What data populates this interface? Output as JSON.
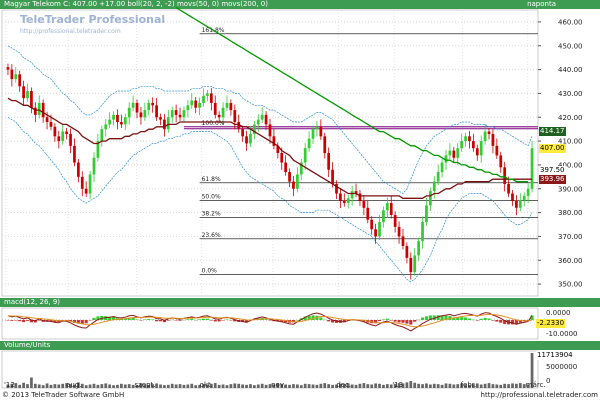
{
  "price_panel": {
    "header": "Magyar Telekom  C: 407.00  +17.00  boll(20, 2, -2)  movs(50, 0)  movs(200, 0)",
    "period": "naponta",
    "watermark_title": "TeleTrader Professional",
    "watermark_url": "http://professional.teletrader.com",
    "badges": [
      {
        "text": "414.17",
        "bg": "#1f5f1f",
        "fg": "#ffffff"
      },
      {
        "text": "407.00",
        "bg": "#ffeb3b",
        "fg": "#000000"
      },
      {
        "text": "397.50",
        "bg": "#ffffff",
        "fg": "#000000"
      },
      {
        "text": "393.96",
        "bg": "#8b1a1a",
        "fg": "#ffffff"
      }
    ]
  },
  "macd_panel": {
    "header": "macd(12, 26, 9)",
    "badges": [
      {
        "text": "-2.2330",
        "bg": "#ffeb3b",
        "fg": "#000000"
      }
    ],
    "tick_labels": [
      "0.0000",
      "-10.0000"
    ]
  },
  "volume_panel": {
    "header": "Volume/Units",
    "badges": [
      {
        "text": "11713904",
        "bg": "#ffffff",
        "fg": "#000000"
      }
    ],
    "tick_labels": [
      "5000000",
      "0"
    ]
  },
  "footer": {
    "copyright": "© 2013 TeleTrader Software GmbH",
    "url": "http://professional.teletrader.com"
  },
  "colors": {
    "header_bg": "#3e9b52",
    "up_candle": "#33cc33",
    "down_candle": "#cc0000",
    "sma50": "#7a1010",
    "sma200": "#009900",
    "bollinger": "#2b8fd6",
    "fib": "#000000",
    "resistance": "#800080",
    "macd_line": "#8b1a1a",
    "signal_line": "#e09020"
  },
  "chart_data": [
    {
      "type": "candlestick",
      "y_ticks": [
        350,
        360,
        370,
        380,
        390,
        400,
        410,
        420,
        430,
        440,
        450,
        460
      ],
      "ylim": [
        345,
        465
      ],
      "x_tick_labels": [
        "'12",
        "aug.",
        "szept.",
        "okt.",
        "nov.",
        "dec.",
        "'13",
        "febr.",
        "márc."
      ],
      "fibonacci": [
        {
          "label": "161.8%",
          "value": 455.0
        },
        {
          "label": "100.0%",
          "value": 416.0
        },
        {
          "label": "61.8%",
          "value": 392.5
        },
        {
          "label": "50.0%",
          "value": 385.0
        },
        {
          "label": "38.2%",
          "value": 378.0
        },
        {
          "label": "23.6%",
          "value": 369.0
        },
        {
          "label": "0.0%",
          "value": 354.0
        }
      ],
      "resistance_level": 416.0,
      "series_close": [
        440,
        436,
        438,
        433,
        428,
        431,
        424,
        421,
        426,
        420,
        418,
        416,
        412,
        410,
        414,
        413,
        408,
        401,
        395,
        390,
        388,
        396,
        403,
        410,
        415,
        417,
        419,
        421,
        418,
        417,
        420,
        424,
        426,
        422,
        420,
        423,
        426,
        425,
        420,
        419,
        415,
        420,
        423,
        421,
        420,
        423,
        425,
        427,
        424,
        426,
        429,
        430,
        426,
        421,
        420,
        424,
        426,
        423,
        418,
        415,
        412,
        409,
        413,
        417,
        419,
        421,
        417,
        412,
        408,
        405,
        401,
        397,
        393,
        390,
        396,
        401,
        407,
        411,
        415,
        416,
        412,
        405,
        398,
        392,
        388,
        385,
        384,
        386,
        389,
        388,
        385,
        382,
        377,
        373,
        370,
        376,
        381,
        384,
        379,
        374,
        370,
        366,
        361,
        355,
        362,
        368,
        376,
        383,
        389,
        393,
        397,
        401,
        404,
        406,
        403,
        407,
        410,
        412,
        410,
        407,
        404,
        410,
        414,
        413,
        408,
        404,
        399,
        392,
        388,
        385,
        382,
        385,
        387,
        390,
        407
      ],
      "series_sma50": [
        428,
        427,
        427,
        426,
        425,
        425,
        424,
        423,
        423,
        422,
        421,
        420,
        419,
        418,
        417,
        417,
        416,
        415,
        414,
        412,
        411,
        410,
        409,
        409,
        410,
        410,
        411,
        411,
        411,
        411,
        412,
        412,
        413,
        413,
        414,
        414,
        415,
        415,
        416,
        416,
        416,
        417,
        417,
        417,
        418,
        418,
        418,
        418,
        418,
        418,
        418,
        418,
        418,
        418,
        418,
        418,
        418,
        418,
        417,
        417,
        416,
        416,
        415,
        414,
        413,
        412,
        411,
        410,
        409,
        408,
        406,
        405,
        404,
        402,
        401,
        400,
        399,
        398,
        397,
        396,
        395,
        394,
        393,
        392,
        391,
        390,
        389,
        388,
        388,
        388,
        387,
        387,
        387,
        387,
        387,
        387,
        387,
        387,
        387,
        387,
        387,
        386,
        386,
        386,
        386,
        386,
        386,
        387,
        387,
        388,
        388,
        389,
        390,
        390,
        391,
        392,
        392,
        393,
        393,
        393,
        393,
        393,
        393,
        393,
        394,
        394,
        394,
        394,
        394,
        394,
        394,
        394,
        394,
        394,
        394
      ],
      "series_sma200_start_index": 43,
      "series_sma200": [
        466,
        465,
        464,
        463,
        462,
        461,
        460,
        459,
        458,
        457,
        456,
        455,
        454,
        453,
        452,
        451,
        450,
        449,
        448,
        447,
        446,
        445,
        444,
        443,
        442,
        441,
        440,
        439,
        438,
        437,
        436,
        435,
        434,
        433,
        432,
        431,
        430,
        429,
        428,
        427,
        426,
        425,
        424,
        423,
        422,
        421,
        420,
        419,
        418,
        417,
        416,
        415,
        414,
        414,
        413,
        412,
        411,
        411,
        410,
        409,
        408,
        408,
        407,
        406,
        406,
        405,
        404,
        404,
        403,
        402,
        402,
        401,
        401,
        400,
        400,
        399,
        399,
        398,
        398,
        397,
        397,
        396,
        396,
        395,
        395,
        394,
        394,
        393,
        393,
        393,
        393
      ],
      "series_bb_upper": [
        450,
        449,
        448,
        447,
        445,
        444,
        443,
        441,
        440,
        438,
        437,
        436,
        434,
        432,
        430,
        429,
        427,
        426,
        424,
        422,
        421,
        421,
        422,
        423,
        425,
        427,
        429,
        430,
        431,
        431,
        431,
        431,
        432,
        432,
        433,
        433,
        433,
        433,
        432,
        432,
        431,
        431,
        431,
        431,
        431,
        431,
        431,
        432,
        432,
        432,
        433,
        433,
        433,
        432,
        432,
        432,
        431,
        431,
        430,
        430,
        428,
        427,
        426,
        425,
        425,
        425,
        424,
        423,
        423,
        422,
        421,
        420,
        419,
        418,
        418,
        418,
        419,
        420,
        421,
        422,
        422,
        421,
        420,
        419,
        417,
        415,
        413,
        411,
        409,
        407,
        405,
        403,
        401,
        399,
        397,
        395,
        393,
        392,
        391,
        390,
        389,
        388,
        390,
        394,
        398,
        402,
        405,
        408,
        410,
        412,
        413,
        414,
        415,
        416,
        417,
        417,
        418,
        418,
        418,
        417,
        417,
        417,
        417,
        416,
        416,
        415,
        415,
        414,
        413,
        412,
        411,
        410,
        409,
        408,
        412
      ],
      "series_bb_lower": [
        420,
        419,
        418,
        416,
        414,
        413,
        411,
        409,
        408,
        406,
        404,
        402,
        400,
        398,
        395,
        393,
        390,
        388,
        386,
        385,
        384,
        385,
        386,
        387,
        389,
        391,
        393,
        395,
        397,
        398,
        400,
        402,
        404,
        405,
        406,
        407,
        408,
        409,
        409,
        410,
        410,
        411,
        411,
        412,
        412,
        413,
        413,
        414,
        414,
        414,
        414,
        414,
        414,
        413,
        412,
        411,
        410,
        408,
        405,
        402,
        399,
        397,
        395,
        394,
        393,
        392,
        391,
        390,
        389,
        387,
        386,
        385,
        383,
        382,
        381,
        380,
        380,
        380,
        380,
        381,
        381,
        381,
        381,
        380,
        379,
        378,
        377,
        376,
        375,
        374,
        373,
        372,
        371,
        370,
        368,
        366,
        364,
        362,
        360,
        358,
        356,
        354,
        352,
        351,
        352,
        354,
        356,
        359,
        362,
        366,
        370,
        373,
        377,
        380,
        382,
        384,
        386,
        387,
        388,
        388,
        388,
        388,
        387,
        386,
        385,
        383,
        381,
        379,
        377,
        376,
        375,
        375,
        376,
        377,
        380
      ],
      "series_volume_relative": [
        0.1,
        0.12,
        0.14,
        0.09,
        0.15,
        0.11,
        0.3,
        0.12,
        0.1,
        0.08,
        0.13,
        0.09,
        0.11,
        0.1,
        0.12,
        0.14,
        0.11,
        0.09,
        0.16,
        0.12,
        0.08,
        0.1,
        0.12,
        0.09,
        0.11,
        0.13,
        0.1,
        0.08,
        0.09,
        0.12,
        0.1,
        0.11,
        0.09,
        0.08,
        0.12,
        0.1,
        0.09,
        0.11,
        0.13,
        0.1,
        0.08,
        0.09,
        0.12,
        0.1,
        0.11,
        0.09,
        0.1,
        0.12,
        0.08,
        0.09,
        0.11,
        0.1,
        0.12,
        0.14,
        0.09,
        0.1,
        0.08,
        0.11,
        0.13,
        0.12,
        0.1,
        0.09,
        0.11,
        0.08,
        0.1,
        0.12,
        0.09,
        0.11,
        0.1,
        0.13,
        0.12,
        0.1,
        0.09,
        0.11,
        0.1,
        0.08,
        0.12,
        0.11,
        0.1,
        0.09,
        0.12,
        0.14,
        0.11,
        0.09,
        0.1,
        0.12,
        0.11,
        0.13,
        0.1,
        0.09,
        0.12,
        0.14,
        0.11,
        0.1,
        0.13,
        0.12,
        0.09,
        0.11,
        0.1,
        0.12,
        0.14,
        0.13,
        0.16,
        0.2,
        0.15,
        0.12,
        0.11,
        0.13,
        0.1,
        0.12,
        0.11,
        0.09,
        0.13,
        0.12,
        0.1,
        0.11,
        0.12,
        0.1,
        0.09,
        0.11,
        0.13,
        0.1,
        0.12,
        0.14,
        0.11,
        0.1,
        0.09,
        0.12,
        0.11,
        0.13,
        0.12,
        0.14,
        0.11,
        0.1,
        1.0
      ]
    }
  ]
}
